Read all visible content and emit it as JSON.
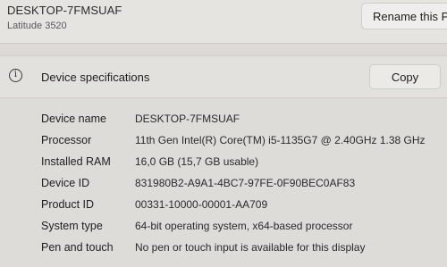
{
  "device": {
    "name": "DESKTOP-7FMSUAF",
    "model": "Latitude 3520",
    "rename_label": "Rename this PC"
  },
  "specs": {
    "title": "Device specifications",
    "copy_label": "Copy",
    "info_icon_glyph": "i",
    "rows": [
      {
        "label": "Device name",
        "value": "DESKTOP-7FMSUAF"
      },
      {
        "label": "Processor",
        "value": "11th Gen Intel(R) Core(TM) i5-1135G7 @ 2.40GHz   1.38 GHz"
      },
      {
        "label": "Installed RAM",
        "value": "16,0 GB (15,7 GB usable)"
      },
      {
        "label": "Device ID",
        "value": "831980B2-A9A1-4BC7-97FE-0F90BEC0AF83"
      },
      {
        "label": "Product ID",
        "value": "00331-10000-00001-AA709"
      },
      {
        "label": "System type",
        "value": "64-bit operating system, x64-based processor"
      },
      {
        "label": "Pen and touch",
        "value": "No pen or touch input is available for this display"
      }
    ]
  }
}
